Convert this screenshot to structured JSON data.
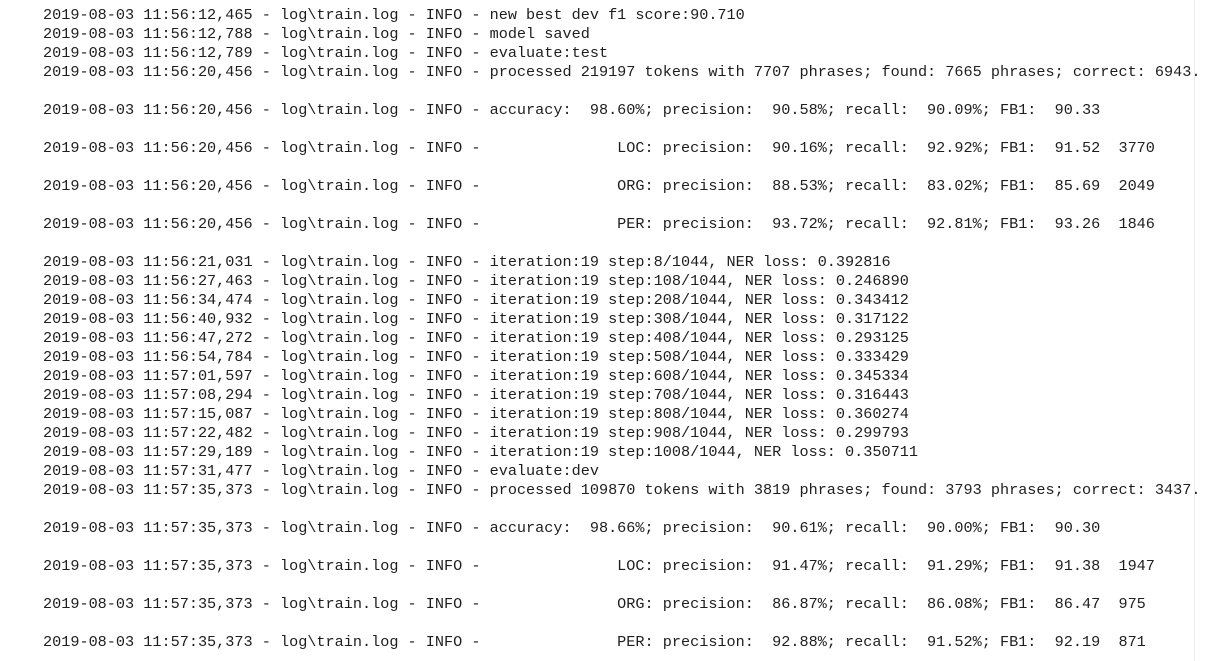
{
  "log": {
    "lines": [
      "2019-08-03 11:56:12,465 - log\\train.log - INFO - new best dev f1 score:90.710",
      "2019-08-03 11:56:12,788 - log\\train.log - INFO - model saved",
      "2019-08-03 11:56:12,789 - log\\train.log - INFO - evaluate:test",
      "2019-08-03 11:56:20,456 - log\\train.log - INFO - processed 219197 tokens with 7707 phrases; found: 7665 phrases; correct: 6943.",
      "",
      "2019-08-03 11:56:20,456 - log\\train.log - INFO - accuracy:  98.60%; precision:  90.58%; recall:  90.09%; FB1:  90.33",
      "",
      "2019-08-03 11:56:20,456 - log\\train.log - INFO -               LOC: precision:  90.16%; recall:  92.92%; FB1:  91.52  3770",
      "",
      "2019-08-03 11:56:20,456 - log\\train.log - INFO -               ORG: precision:  88.53%; recall:  83.02%; FB1:  85.69  2049",
      "",
      "2019-08-03 11:56:20,456 - log\\train.log - INFO -               PER: precision:  93.72%; recall:  92.81%; FB1:  93.26  1846",
      "",
      "2019-08-03 11:56:21,031 - log\\train.log - INFO - iteration:19 step:8/1044, NER loss: 0.392816",
      "2019-08-03 11:56:27,463 - log\\train.log - INFO - iteration:19 step:108/1044, NER loss: 0.246890",
      "2019-08-03 11:56:34,474 - log\\train.log - INFO - iteration:19 step:208/1044, NER loss: 0.343412",
      "2019-08-03 11:56:40,932 - log\\train.log - INFO - iteration:19 step:308/1044, NER loss: 0.317122",
      "2019-08-03 11:56:47,272 - log\\train.log - INFO - iteration:19 step:408/1044, NER loss: 0.293125",
      "2019-08-03 11:56:54,784 - log\\train.log - INFO - iteration:19 step:508/1044, NER loss: 0.333429",
      "2019-08-03 11:57:01,597 - log\\train.log - INFO - iteration:19 step:608/1044, NER loss: 0.345334",
      "2019-08-03 11:57:08,294 - log\\train.log - INFO - iteration:19 step:708/1044, NER loss: 0.316443",
      "2019-08-03 11:57:15,087 - log\\train.log - INFO - iteration:19 step:808/1044, NER loss: 0.360274",
      "2019-08-03 11:57:22,482 - log\\train.log - INFO - iteration:19 step:908/1044, NER loss: 0.299793",
      "2019-08-03 11:57:29,189 - log\\train.log - INFO - iteration:19 step:1008/1044, NER loss: 0.350711",
      "2019-08-03 11:57:31,477 - log\\train.log - INFO - evaluate:dev",
      "2019-08-03 11:57:35,373 - log\\train.log - INFO - processed 109870 tokens with 3819 phrases; found: 3793 phrases; correct: 3437.",
      "",
      "2019-08-03 11:57:35,373 - log\\train.log - INFO - accuracy:  98.66%; precision:  90.61%; recall:  90.00%; FB1:  90.30",
      "",
      "2019-08-03 11:57:35,373 - log\\train.log - INFO -               LOC: precision:  91.47%; recall:  91.29%; FB1:  91.38  1947",
      "",
      "2019-08-03 11:57:35,373 - log\\train.log - INFO -               ORG: precision:  86.87%; recall:  86.08%; FB1:  86.47  975",
      "",
      "2019-08-03 11:57:35,373 - log\\train.log - INFO -               PER: precision:  92.88%; recall:  91.52%; FB1:  92.19  871"
    ]
  }
}
